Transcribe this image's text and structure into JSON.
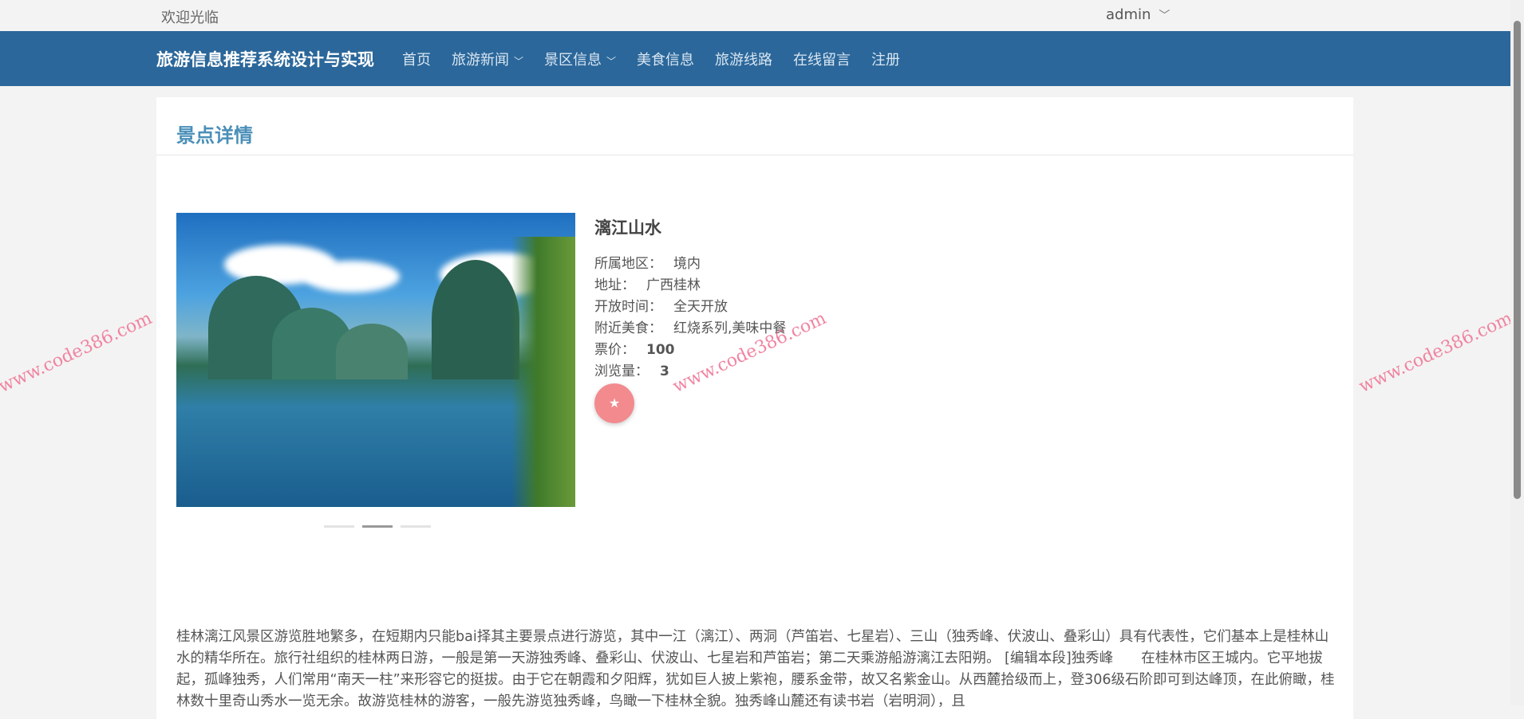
{
  "topbar": {
    "welcome": "欢迎光临",
    "user": "admin"
  },
  "nav": {
    "brand": "旅游信息推荐系统设计与实现",
    "items": [
      {
        "label": "首页",
        "dropdown": false
      },
      {
        "label": "旅游新闻",
        "dropdown": true
      },
      {
        "label": "景区信息",
        "dropdown": true
      },
      {
        "label": "美食信息",
        "dropdown": false
      },
      {
        "label": "旅游线路",
        "dropdown": false
      },
      {
        "label": "在线留言",
        "dropdown": false
      },
      {
        "label": "注册",
        "dropdown": false
      }
    ]
  },
  "page": {
    "title": "景点详情"
  },
  "spot": {
    "name": "漓江山水",
    "region_label": "所属地区：",
    "region": "境内",
    "address_label": "地址：",
    "address": "广西桂林",
    "hours_label": "开放时间：",
    "hours": "全天开放",
    "food_label": "附近美食：",
    "food": "红烧系列,美味中餐",
    "price_label": "票价：",
    "price": "100",
    "views_label": "浏览量：",
    "views": "3",
    "fav_icon": "star-icon",
    "carousel_count": 3,
    "carousel_active": 2
  },
  "description": "桂林漓江风景区游览胜地繁多，在短期内只能bai择其主要景点进行游览，其中一江（漓江）、两洞（芦笛岩、七星岩）、三山（独秀峰、伏波山、叠彩山）具有代表性，它们基本上是桂林山水的精华所在。旅行社组织的桂林两日游，一般是第一天游独秀峰、叠彩山、伏波山、七星岩和芦笛岩；第二天乘游船游漓江去阳朔。 [编辑本段]独秀峰　　在桂林市区王城内。它平地拔起，孤峰独秀，人们常用“南天一柱”来形容它的挺拔。由于它在朝霞和夕阳辉，犹如巨人披上紫袍，腰系金带，故又名紫金山。从西麓拾级而上，登306级石阶即可到达峰顶，在此俯瞰，桂林数十里奇山秀水一览无余。故游览桂林的游客，一般先游览独秀峰，鸟瞰一下桂林全貌。独秀峰山麓还有读书岩（岩明洞），且",
  "watermark": "www.code386.com",
  "colors": {
    "nav": "#2b679a",
    "title": "#4a8fb8",
    "fav": "#f28a8e"
  }
}
